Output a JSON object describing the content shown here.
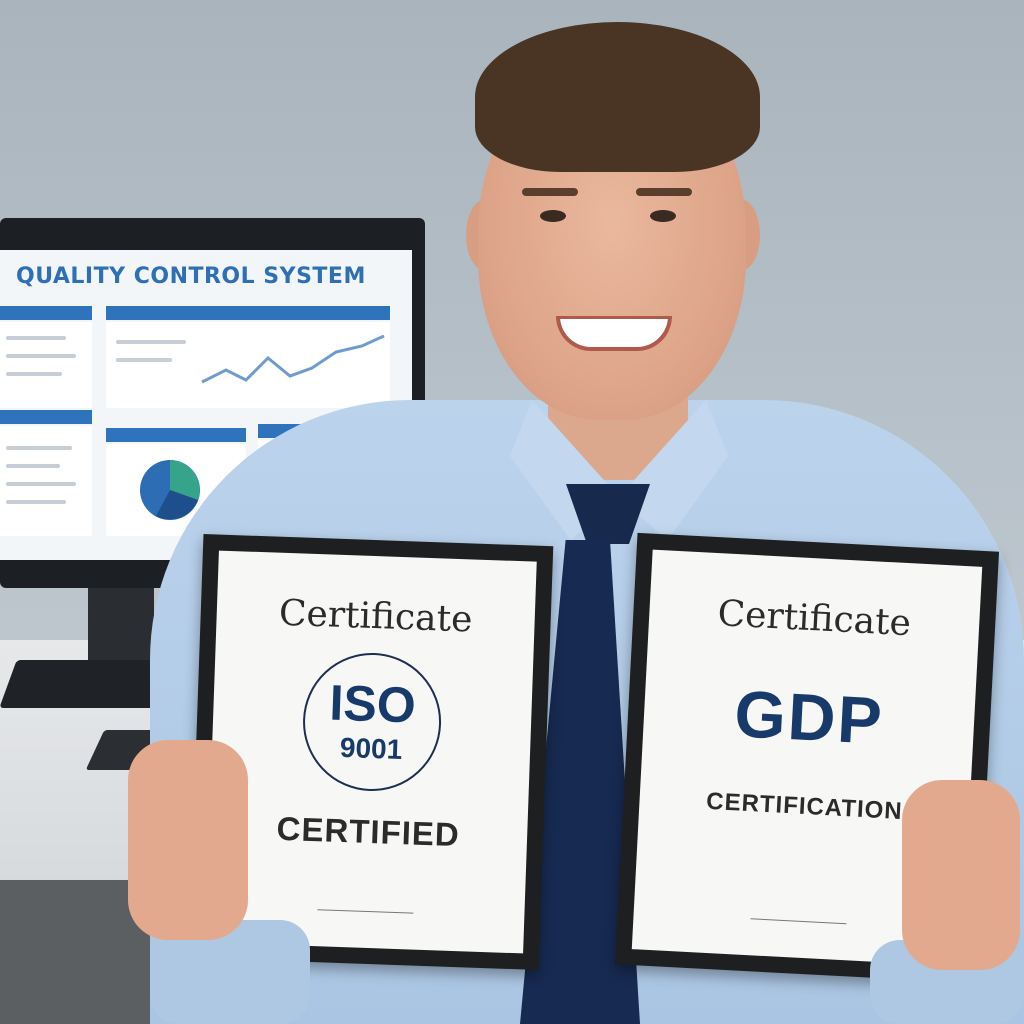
{
  "monitor": {
    "screen_title": "QUALITY CONTROL SYSTEM"
  },
  "certificates": [
    {
      "title": "Certificate",
      "badge_main": "ISO",
      "badge_sub": "9001",
      "status": "CERTIFIED"
    },
    {
      "title": "Certificate",
      "code": "GDP",
      "status": "CERTIFICATION"
    }
  ],
  "colors": {
    "navy": "#173a6b",
    "screen_blue": "#2f73bd",
    "shirt": "#bcd3ec",
    "tie": "#172a52"
  }
}
